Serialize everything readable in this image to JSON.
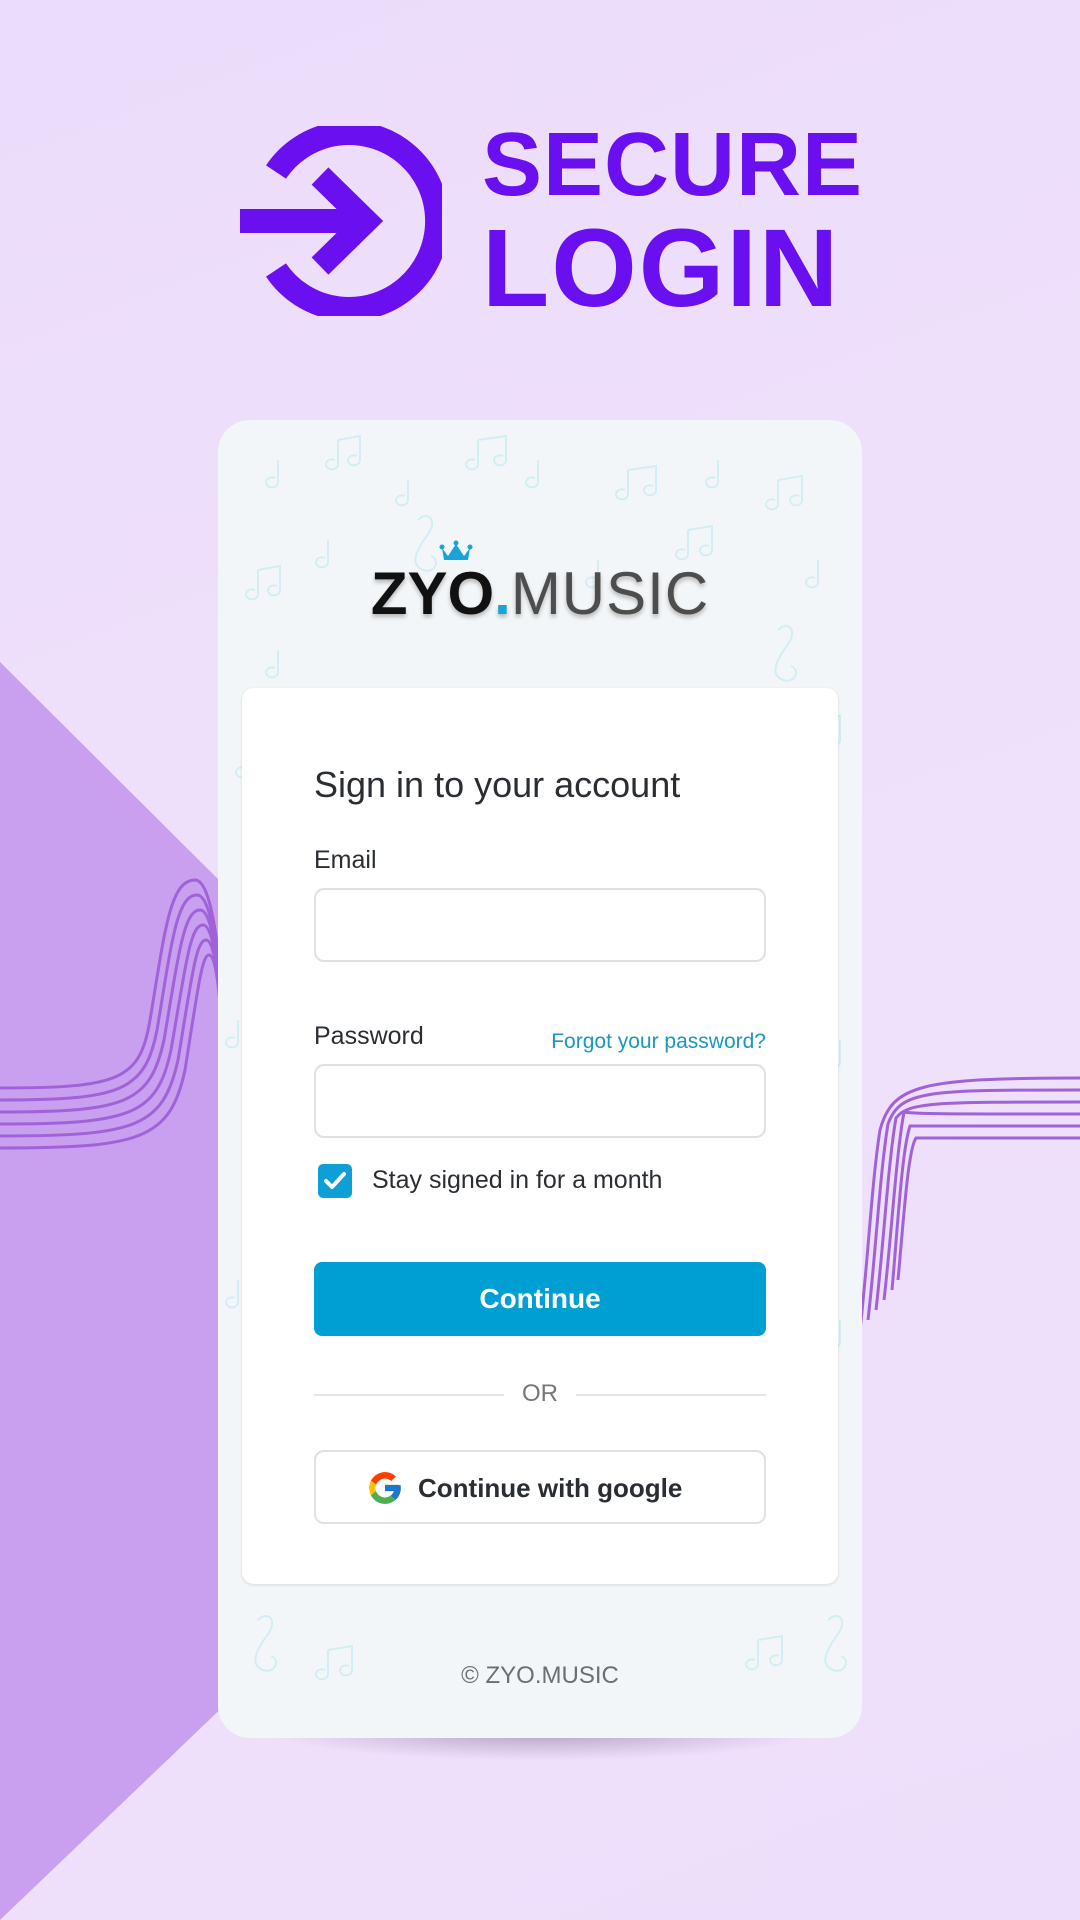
{
  "hero": {
    "title_line1": "SECURE",
    "title_line2": "LOGIN",
    "icon": "login-arrow-circle-icon",
    "accent_color": "#6a0ff0"
  },
  "brand": {
    "name_bold": "ZYO",
    "name_dot": ".",
    "name_light": "MUSIC",
    "crown_icon": "crown-icon",
    "dot_color": "#1aa3d6"
  },
  "form": {
    "title": "Sign in to your account",
    "email_label": "Email",
    "email_value": "",
    "email_placeholder": "",
    "password_label": "Password",
    "password_value": "",
    "password_placeholder": "",
    "forgot_link": "Forgot your password?",
    "remember_label": "Stay signed in for a month",
    "remember_checked": true,
    "continue_label": "Continue",
    "divider_text": "OR",
    "google_label": "Continue with google",
    "google_icon": "google-g-icon",
    "primary_color": "#009fd3"
  },
  "footer": {
    "copyright": "© ZYO.MUSIC"
  },
  "colors": {
    "background": "#efe1fb",
    "wedge": "#c99df0",
    "wave_stroke": "#9f62d6"
  }
}
